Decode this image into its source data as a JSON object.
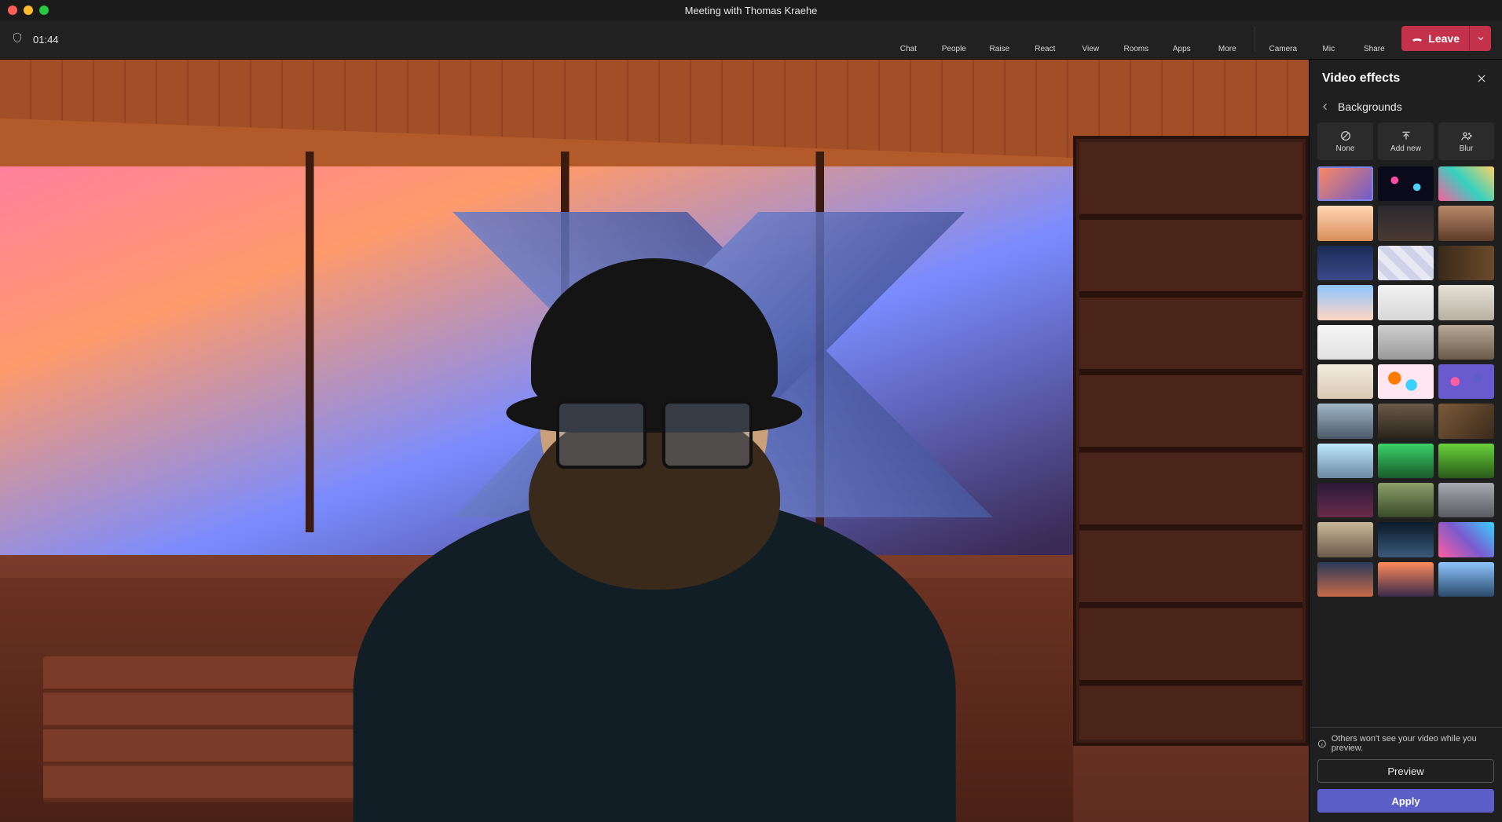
{
  "window": {
    "title": "Meeting with Thomas Kraehe"
  },
  "toolbar": {
    "timer": "01:44",
    "buttons": {
      "chat": "Chat",
      "people": "People",
      "raise": "Raise",
      "react": "React",
      "view": "View",
      "rooms": "Rooms",
      "apps": "Apps",
      "more": "More",
      "camera": "Camera",
      "mic": "Mic",
      "share": "Share"
    },
    "leave": "Leave"
  },
  "panel": {
    "title": "Video effects",
    "back_label": "Backgrounds",
    "actions": {
      "none": "None",
      "add_new": "Add new",
      "blur": "Blur"
    },
    "info": "Others won't see your video while you preview.",
    "preview": "Preview",
    "apply": "Apply",
    "thumbs": [
      {
        "name": "sunset-study",
        "selected": true,
        "css": "linear-gradient(135deg,#ff8a5c,#6a5acd)"
      },
      {
        "name": "bokeh-dark",
        "selected": false,
        "css": "radial-gradient(circle at 30% 40%,#ff4da6 0 8%,transparent 9%),radial-gradient(circle at 70% 60%,#4dd2ff 0 8%,transparent 9%),#0a0a1a"
      },
      {
        "name": "swirl-paint",
        "selected": false,
        "css": "linear-gradient(45deg,#ff5ea0,#34d1bf,#ffd166)"
      },
      {
        "name": "cozy-desk",
        "selected": false,
        "css": "linear-gradient(180deg,#ffd7b5,#d98e5b)"
      },
      {
        "name": "dim-bedroom",
        "selected": false,
        "css": "linear-gradient(180deg,#2a2a30,#4a3a30)"
      },
      {
        "name": "shop-window",
        "selected": false,
        "css": "linear-gradient(180deg,#b9896a,#5e3c28)"
      },
      {
        "name": "night-sky",
        "selected": false,
        "css": "linear-gradient(180deg,#1a2a55,#3a4a8a)"
      },
      {
        "name": "sticky-notes",
        "selected": false,
        "css": "repeating-linear-gradient(45deg,#e8e8f2 0 10px,#cfd2e8 10px 20px)"
      },
      {
        "name": "bookshelf-narrow",
        "selected": false,
        "css": "linear-gradient(90deg,#3a2a1a,#6a4a2a)"
      },
      {
        "name": "sky-gradient",
        "selected": false,
        "css": "linear-gradient(180deg,#8ec5ff,#ffd6c2)"
      },
      {
        "name": "white-room-window",
        "selected": false,
        "css": "linear-gradient(180deg,#f2f2f2,#d8d8d8)"
      },
      {
        "name": "gallery-bench",
        "selected": false,
        "css": "linear-gradient(180deg,#e8e2d8,#b8b0a2)"
      },
      {
        "name": "white-loft",
        "selected": false,
        "css": "linear-gradient(180deg,#f6f6f6,#e2e2e2)"
      },
      {
        "name": "grey-studio",
        "selected": false,
        "css": "linear-gradient(180deg,#cfcfcf,#9a9a9a)"
      },
      {
        "name": "industrial-loft",
        "selected": false,
        "css": "linear-gradient(180deg,#b8a898,#6a5a4a)"
      },
      {
        "name": "cream-room",
        "selected": false,
        "css": "linear-gradient(180deg,#f4ecdf,#d8c8b2)"
      },
      {
        "name": "balloons",
        "selected": false,
        "css": "radial-gradient(circle at 30% 40%,#ff7a00 0 14%,transparent 15%),radial-gradient(circle at 60% 60%,#3ad1ff 0 14%,transparent 15%),#ffe6f0"
      },
      {
        "name": "floating-shapes",
        "selected": false,
        "css": "radial-gradient(circle at 30% 50%,#ff5ea0 0 10%,transparent 11%),radial-gradient(circle at 70% 40%,#5b5fc7 0 10%,transparent 11%),#6a5acd"
      },
      {
        "name": "bridge",
        "selected": false,
        "css": "linear-gradient(180deg,#a0b8c8,#4a5a6a)"
      },
      {
        "name": "lounge",
        "selected": false,
        "css": "linear-gradient(180deg,#6a5a4a,#2a221a)"
      },
      {
        "name": "cafe-corner",
        "selected": false,
        "css": "linear-gradient(135deg,#7a5a3a,#3a2a1a)"
      },
      {
        "name": "minecraft-snow",
        "selected": false,
        "css": "linear-gradient(180deg,#bfe8ff,#6a8aa0)"
      },
      {
        "name": "minecraft-jungle",
        "selected": false,
        "css": "linear-gradient(180deg,#3ad16a,#1a5a2a)"
      },
      {
        "name": "minecraft-plains",
        "selected": false,
        "css": "linear-gradient(180deg,#6ad13a,#2a5a1a)"
      },
      {
        "name": "pixel-night",
        "selected": false,
        "css": "linear-gradient(180deg,#2a1a3a,#6a2a4a)"
      },
      {
        "name": "valley",
        "selected": false,
        "css": "linear-gradient(180deg,#8aa06a,#3a4a2a)"
      },
      {
        "name": "stone-arch",
        "selected": false,
        "css": "linear-gradient(180deg,#a8a8b0,#5a5a62)"
      },
      {
        "name": "alley-arch",
        "selected": false,
        "css": "linear-gradient(180deg,#c8b898,#6a5a4a)"
      },
      {
        "name": "planet-horizon",
        "selected": false,
        "css": "linear-gradient(180deg,#0a1a2a,#3a5a7a)"
      },
      {
        "name": "pink-nebula",
        "selected": false,
        "css": "linear-gradient(45deg,#ff5ea0,#7a5acd,#3ad1ff)"
      },
      {
        "name": "coast-dusk",
        "selected": false,
        "css": "linear-gradient(180deg,#2a3a5a,#c86a4a)"
      },
      {
        "name": "city-sunset",
        "selected": false,
        "css": "linear-gradient(180deg,#ff8a5c,#3a2a4a)"
      },
      {
        "name": "glacier-lake",
        "selected": false,
        "css": "linear-gradient(180deg,#8ec5ff,#2a4a6a)"
      }
    ]
  }
}
